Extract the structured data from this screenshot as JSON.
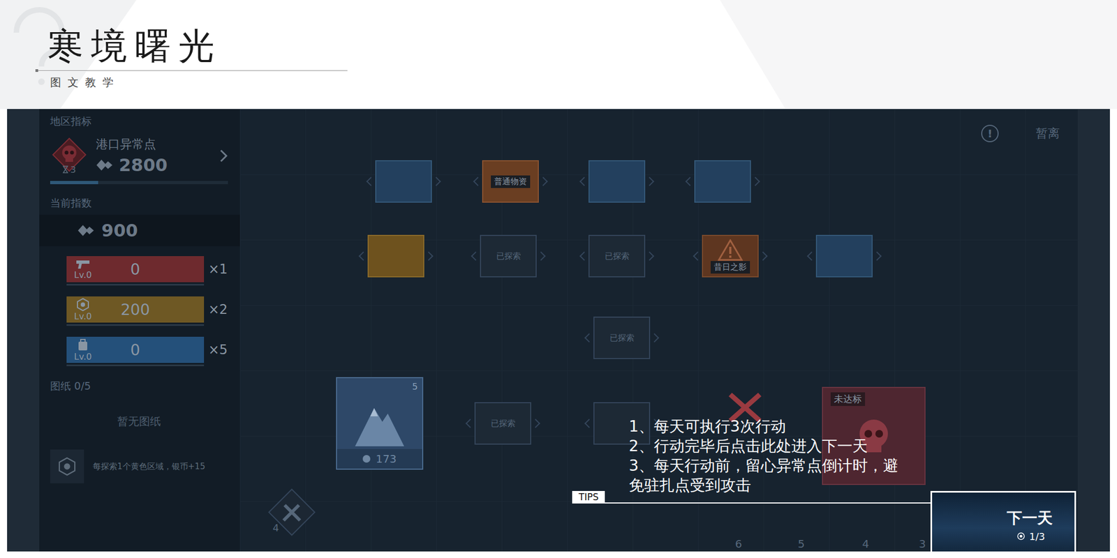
{
  "header": {
    "title": "寒境曙光",
    "subtitle": "图文教学"
  },
  "side_panel": {
    "region_label": "地区指标",
    "region_name": "港口异常点",
    "region_score": "2800",
    "region_level": "3",
    "region_progress": 0.27,
    "index_label": "当前指数",
    "index_value": "900",
    "resources": [
      {
        "kind": "weapon",
        "level": "Lv.0",
        "value": "0",
        "count": "×1",
        "color": "#6e2a2e"
      },
      {
        "kind": "coin",
        "level": "Lv.0",
        "value": "200",
        "count": "×2",
        "color": "#6e5824"
      },
      {
        "kind": "supply",
        "level": "Lv.0",
        "value": "0",
        "count": "×5",
        "color": "#24507a"
      }
    ],
    "blueprint_label": "图纸 0/5",
    "blueprint_empty": "暂无图纸",
    "blueprint_hint": "每探索1个黄色区域，银币+15"
  },
  "topbar": {
    "alert": "!",
    "leave": "暂离"
  },
  "tiles": [
    {
      "kind": "blue",
      "label": ""
    },
    {
      "kind": "supply",
      "label": "普通物资"
    },
    {
      "kind": "blue",
      "label": ""
    },
    {
      "kind": "blue",
      "label": ""
    },
    {
      "kind": "yellow",
      "label": ""
    },
    {
      "kind": "explored",
      "label": "已探索"
    },
    {
      "kind": "explored",
      "label": "已探索"
    },
    {
      "kind": "danger",
      "label": "昔日之影"
    },
    {
      "kind": "blue",
      "label": ""
    },
    {
      "kind": "explored",
      "label": "已探索"
    },
    {
      "kind": "explored",
      "label": "已探索"
    },
    {
      "kind": "explored",
      "label": ""
    },
    {
      "kind": "crossed",
      "label": ""
    }
  ],
  "base": {
    "value": "173",
    "badge": "5"
  },
  "enemy": {
    "label": "未达标"
  },
  "tool": {
    "count": "4"
  },
  "axis": [
    "6",
    "5",
    "4",
    "3"
  ],
  "tips": {
    "label": "TIPS",
    "lines": [
      "1、每天可执行3次行动",
      "2、行动完毕后点击此处进入下一天",
      "3、每天行动前，留心异常点倒计时，避免驻扎点受到攻击"
    ]
  },
  "next_day": {
    "label": "下一天",
    "counter": "1/3"
  }
}
